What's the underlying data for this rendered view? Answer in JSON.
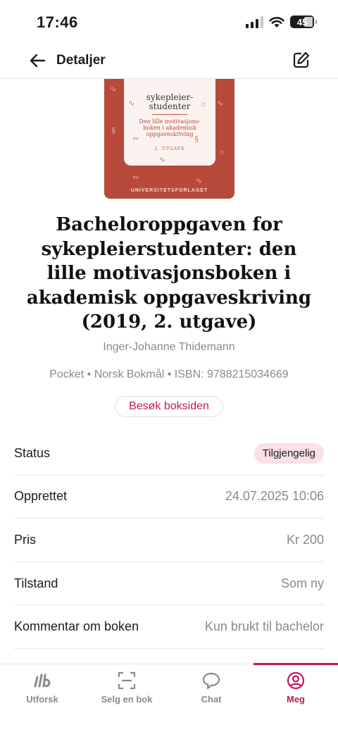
{
  "status_bar": {
    "time": "17:46",
    "battery": "45"
  },
  "header": {
    "title": "Detaljer",
    "back_icon": "arrow-left-icon",
    "edit_icon": "edit-icon"
  },
  "cover": {
    "title": "sykepleier-\nstudenter",
    "subtitle": "Den lille motivasjons-\nboken i akademisk\noppgaveskriving",
    "edition": "2. UTGAVE",
    "publisher": "UNIVERSITETSFORLAGET",
    "background_color": "#b84a3c"
  },
  "book": {
    "title": "Bacheloroppgaven for sykepleierstudenter: den lille motivasjonsboken i akademisk oppgaveskriving (2019, 2. utgave)",
    "author": "Inger-Johanne Thidemann",
    "meta": "Pocket • Norsk Bokmål • ISBN: 9788215034669",
    "visit_button": "Besøk boksiden"
  },
  "details": [
    {
      "label": "Status",
      "value": "Tilgjengelig"
    },
    {
      "label": "Opprettet",
      "value": "24.07.2025 10:06"
    },
    {
      "label": "Pris",
      "value": "Kr 200"
    },
    {
      "label": "Tilstand",
      "value": "Som ny"
    },
    {
      "label": "Kommentar om boken",
      "value": "Kun brukt til bachelor"
    }
  ],
  "tabs": [
    {
      "label": "Utforsk",
      "icon": "logo-icon"
    },
    {
      "label": "Selg en bok",
      "icon": "scan-icon"
    },
    {
      "label": "Chat",
      "icon": "chat-icon"
    },
    {
      "label": "Meg",
      "icon": "profile-icon"
    }
  ],
  "colors": {
    "accent": "#c2185b",
    "badge_bg": "#fbe0e6",
    "muted_text": "#8a8a8a"
  }
}
